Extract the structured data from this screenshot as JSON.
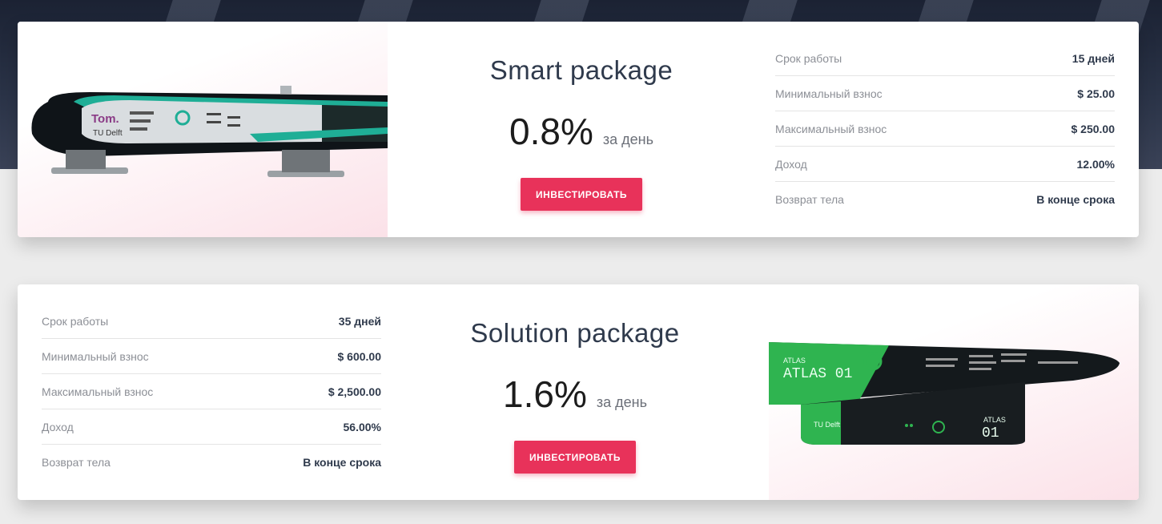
{
  "packages": [
    {
      "title": "Smart package",
      "rate": "0.8%",
      "rate_unit": "за день",
      "button_label": "ИНВЕСТИРОВАТЬ",
      "details": [
        {
          "label": "Срок работы",
          "value": "15 дней"
        },
        {
          "label": "Минимальный взнос",
          "value": "$ 25.00"
        },
        {
          "label": "Максимальный взнос",
          "value": "$ 250.00"
        },
        {
          "label": "Доход",
          "value": "12.00%"
        },
        {
          "label": "Возврат тела",
          "value": "В конце срока"
        }
      ],
      "image": {
        "kind": "hyperloop-pod-image",
        "brand_text": "Tom.",
        "sub_text": "TU Delft"
      }
    },
    {
      "title": "Solution package",
      "rate": "1.6%",
      "rate_unit": "за день",
      "button_label": "ИНВЕСТИРОВАТЬ",
      "details": [
        {
          "label": "Срок работы",
          "value": "35 дней"
        },
        {
          "label": "Минимальный взнос",
          "value": "$ 600.00"
        },
        {
          "label": "Максимальный взнос",
          "value": "$ 2,500.00"
        },
        {
          "label": "Доход",
          "value": "56.00%"
        },
        {
          "label": "Возврат тела",
          "value": "В конце срока"
        }
      ],
      "image": {
        "kind": "hyperloop-pod-image",
        "brand_text": "ATLAS 01",
        "sub_text": "TU Delft"
      }
    }
  ],
  "colors": {
    "accent": "#e8325a",
    "title": "#2f3a4c",
    "label": "#8c8f96",
    "pod_teal": "#1fae96",
    "pod_green": "#2fb450"
  }
}
